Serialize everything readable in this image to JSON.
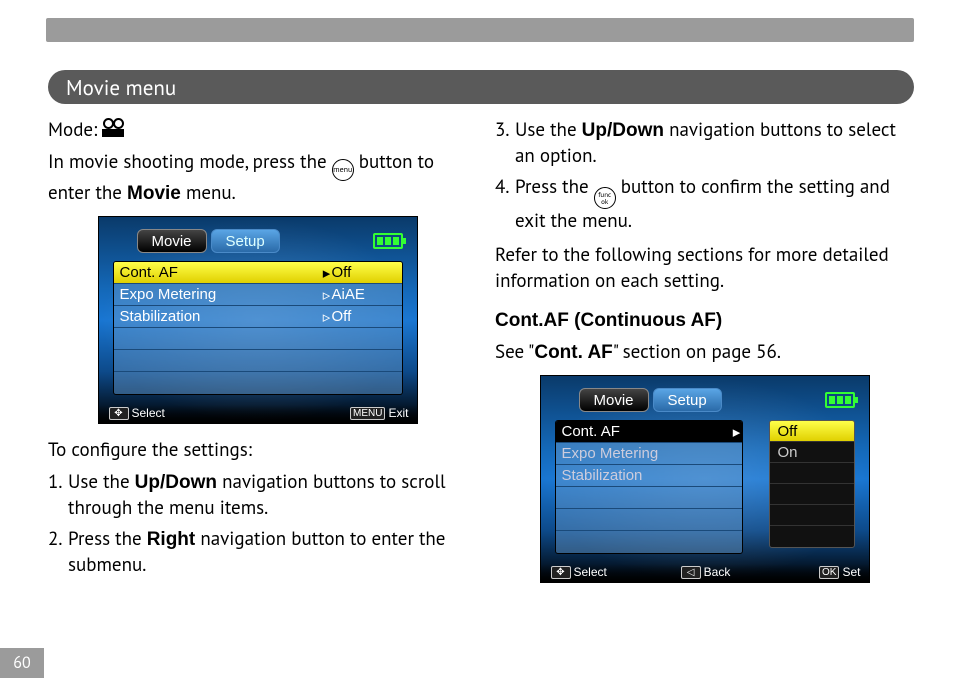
{
  "page_number": "60",
  "header_title": "Movie menu",
  "left": {
    "mode_label": "Mode:",
    "intro_pre": "In movie shooting mode, press the ",
    "intro_post": " button to enter the ",
    "intro_bold": "Movie",
    "intro_tail": " menu.",
    "configure_label": "To configure the settings:",
    "step1_pre": "Use the ",
    "step1_bold": "Up/Down",
    "step1_post": " navigation buttons to scroll through the menu items.",
    "step2_pre": "Press the ",
    "step2_bold": "Right",
    "step2_post": " navigation button to enter the submenu."
  },
  "right": {
    "step3_pre": "Use the ",
    "step3_bold": "Up/Down",
    "step3_post": " navigation buttons to select an option.",
    "step4_pre": "Press the ",
    "step4_post": " button to confirm the setting and exit the menu.",
    "refer": "Refer to the following sections for more detailed information on each setting.",
    "contaf_heading": "Cont.AF (Continuous AF)",
    "contaf_pre": "See \"",
    "contaf_bold": "Cont. AF",
    "contaf_post": "\" section on page 56."
  },
  "lcd1": {
    "tab_active": "Movie",
    "tab_inactive": "Setup",
    "items": [
      {
        "label": "Cont. AF",
        "val": "Off",
        "sel": true
      },
      {
        "label": "Expo Metering",
        "val": "AiAE",
        "sel": false
      },
      {
        "label": "Stabilization",
        "val": "Off",
        "sel": false
      }
    ],
    "foot_left": "Select",
    "foot_right_btn": "MENU",
    "foot_right": "Exit"
  },
  "lcd2": {
    "tab_active": "Movie",
    "tab_inactive": "Setup",
    "left_items": [
      "Cont. AF",
      "Expo Metering",
      "Stabilization"
    ],
    "submenu": [
      "Off",
      "On"
    ],
    "foot_left": "Select",
    "foot_mid": "Back",
    "foot_right_btn": "OK",
    "foot_right": "Set"
  }
}
